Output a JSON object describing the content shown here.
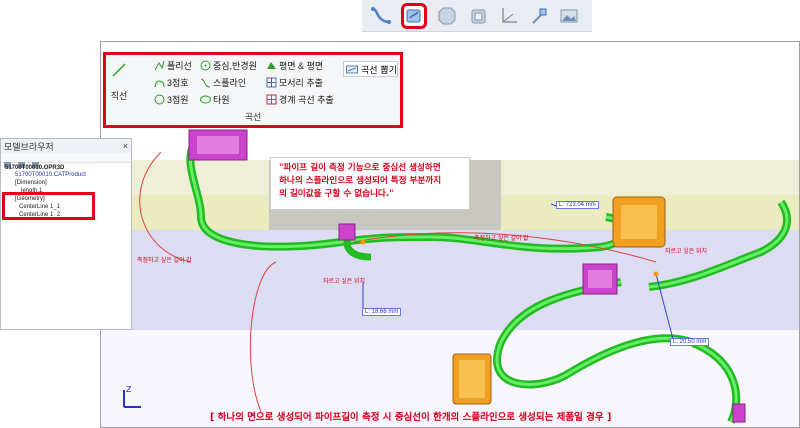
{
  "toolbar": {
    "buttons": [
      {
        "icon": "curve-icon"
      },
      {
        "icon": "surface-select-icon",
        "selected": true
      },
      {
        "icon": "octagon-icon"
      },
      {
        "icon": "cube-icon"
      },
      {
        "icon": "axis-icon"
      },
      {
        "icon": "pointer-icon"
      },
      {
        "icon": "image-icon"
      }
    ]
  },
  "ribbon": {
    "line": "직선",
    "polyline": "폴리선",
    "arc3": "3점호",
    "circle3": "3점원",
    "center_radius": "중심,반경원",
    "spline": "스플라인",
    "ellipse": "타원",
    "plane_plane": "평면 & 평면",
    "edge_extract": "모서리 추출",
    "boundary_extract": "경계 곡선 추출",
    "curve_extract": "곡선 뽑기",
    "group": "곡선"
  },
  "browser": {
    "title": "모델브라우저",
    "close": "×",
    "rows": [
      "51700T00010.OPR3D",
      "51700T00010.CATProduct",
      "[Dimension]",
      "length.1",
      "[Geometry]",
      "CenterLine 1_1",
      "CenterLine 1_2"
    ]
  },
  "callout": {
    "line1": "\"파이프 길이 측정 기능으로 중심선 생성하면",
    "line2": "하나의 스플라인으로 생성되어 특정 부분까지",
    "line3": "의 길이값을 구할 수 없습니다.\""
  },
  "labels": {
    "measure_left": "측정하고 싶은 길이 값",
    "measure_mid": "측정하고 싶은 길이 값",
    "cut_left": "자르고 싶은 위치",
    "cut_right": "자르고 싶은 위치"
  },
  "measurements": {
    "m1": "L: 723.04 mm",
    "m2": "L: 18.66 mm",
    "m3": "L: 20.50 mm"
  },
  "caption": "[ 하나의 면으로 생성되어 파이프길이 측정 시 중심선이 한개의 스플라인으로 생성되는 제품일 경우 ]",
  "axis": {
    "z": "Z",
    "x": "X"
  },
  "colors": {
    "highlight": "#e0001a",
    "tube": "#33dd33",
    "connector_magenta": "#cc44cc",
    "connector_orange": "#f0a020"
  }
}
